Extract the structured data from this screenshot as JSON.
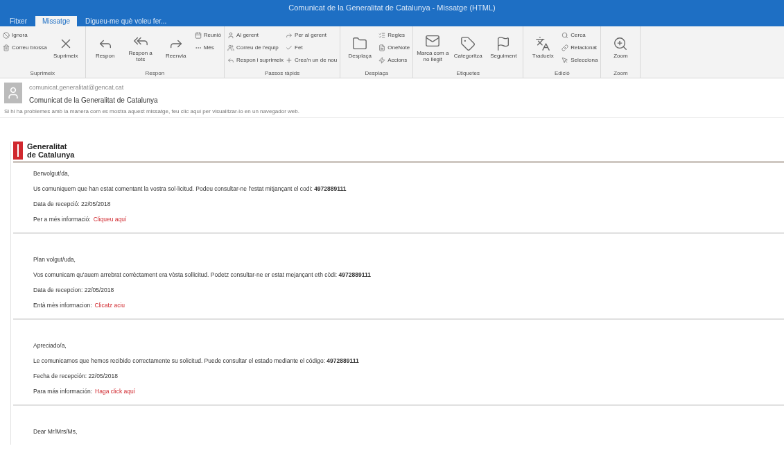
{
  "window": {
    "title": "Comunicat de la Generalitat de Catalunya - Missatge (HTML)"
  },
  "tabs": [
    {
      "label": "Fitxer",
      "selected": false
    },
    {
      "label": "Missatge",
      "selected": true
    },
    {
      "label": "Digueu-me què voleu fer...",
      "selected": false
    }
  ],
  "ribbon": [
    {
      "label": "Suprimeix",
      "buttons": [
        {
          "label": "Ignora",
          "kind": "small"
        },
        {
          "label": "Correu brossa",
          "kind": "small"
        },
        {
          "label": "Suprimeix",
          "kind": "large"
        }
      ]
    },
    {
      "label": "Respon",
      "buttons": [
        {
          "label": "Respon",
          "kind": "large"
        },
        {
          "label": "Respon a tots",
          "kind": "large"
        },
        {
          "label": "Reenvia",
          "kind": "large"
        },
        {
          "label": "Reunió",
          "kind": "small"
        },
        {
          "label": "Més",
          "kind": "small"
        }
      ]
    },
    {
      "label": "Passos ràpids",
      "buttons": [
        {
          "label": "Al gerent",
          "kind": "small"
        },
        {
          "label": "Correu de l'equip",
          "kind": "small"
        },
        {
          "label": "Respon i suprimeix",
          "kind": "small"
        },
        {
          "label": "Per al gerent",
          "kind": "small"
        },
        {
          "label": "Fet",
          "kind": "small"
        },
        {
          "label": "Crea'n un de nou",
          "kind": "small"
        }
      ]
    },
    {
      "label": "Desplaça",
      "buttons": [
        {
          "label": "Desplaça",
          "kind": "large"
        },
        {
          "label": "Regles",
          "kind": "small"
        },
        {
          "label": "OneNote",
          "kind": "small"
        },
        {
          "label": "Accions",
          "kind": "small"
        }
      ]
    },
    {
      "label": "Etiquetes",
      "buttons": [
        {
          "label": "Marca com a no llegit",
          "kind": "large"
        },
        {
          "label": "Categoritza",
          "kind": "large"
        },
        {
          "label": "Seguiment",
          "kind": "large"
        }
      ]
    },
    {
      "label": "Edició",
      "buttons": [
        {
          "label": "Tradueix",
          "kind": "large"
        },
        {
          "label": "Cerca",
          "kind": "small"
        },
        {
          "label": "Relacionat",
          "kind": "small"
        },
        {
          "label": "Selecciona",
          "kind": "small"
        }
      ]
    },
    {
      "label": "Zoom",
      "buttons": [
        {
          "label": "Zoom",
          "kind": "large"
        }
      ]
    }
  ],
  "message": {
    "sender": "comunicat.generalitat@gencat.cat",
    "subject": "Comunicat de la Generalitat de Catalunya",
    "infobar": "Si hi ha problemes amb la manera com es mostra aquest missatge, feu clic aquí per visualitzar-lo en un navegador web."
  },
  "logo": {
    "line_1": "Generalitat",
    "line_2": "de Catalunya"
  },
  "sections": [
    {
      "greeting": "Benvolgut/da,",
      "body": "Us comuniquem que han estat comentant la vostra sol·licitud. Podeu consultar-ne l'estat mitjançant el codi: **4972889111**",
      "date": "Data de recepció: 22/05/2018",
      "more": "Per a més informació:",
      "link": "Cliqueu aquí"
    },
    {
      "greeting": "Plan volgut/uda,",
      "body": "Vos comunicam qu'auem arrebrat corrèctament era vòsta sollicitud. Podetz consultar-ne er estat mejançant eth còdi: **4972889111**",
      "date": "Data de recepcion: 22/05/2018",
      "more": "Entà mès informacion:",
      "link": "Clicatz aciu"
    },
    {
      "greeting": "Apreciado/a,",
      "body": "Le comunicamos que hemos recibido correctamente su solicitud. Puede consultar el estado mediante el código: **4972889111**",
      "date": "Fecha de recepción: 22/05/2018",
      "more": "Para más información:",
      "link": "Haga click aquí"
    },
    {
      "greeting": "Dear Mr/Mrs/Ms,"
    }
  ]
}
